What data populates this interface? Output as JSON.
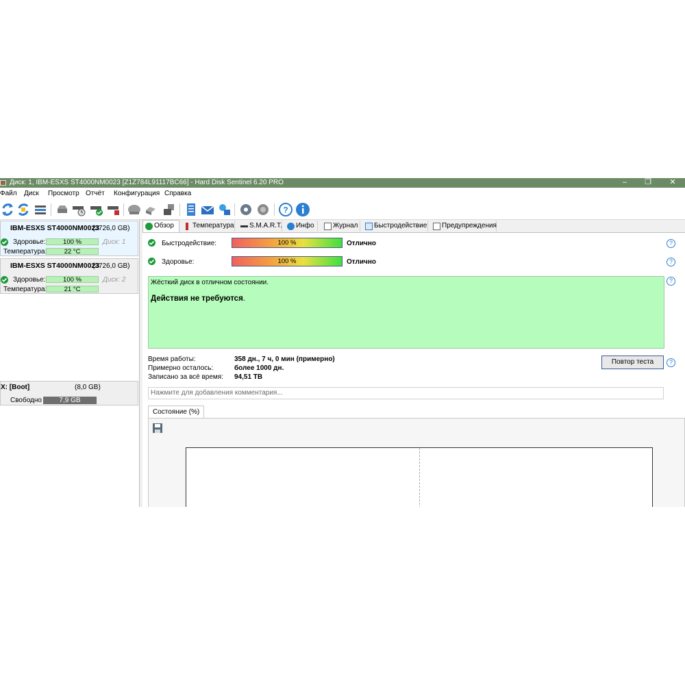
{
  "window": {
    "title": "Диск: 1, IBM-ESXS ST4000NM0023 [Z1Z784L91117BC66]  -  Hard Disk Sentinel 6.20 PRO",
    "controls": {
      "minimize": "–",
      "maximize": "❐",
      "close": "✕"
    }
  },
  "menu": [
    "Файл",
    "Диск",
    "Просмотр",
    "Отчёт",
    "Конфигурация",
    "Справка"
  ],
  "toolbar_icons": [
    "refresh-icon",
    "refresh-all-icon",
    "disk-list-icon",
    "hdd-icon",
    "disk-schedule-icon",
    "disk-ok-icon",
    "disk-stop-icon",
    "cloud-hdd-icon",
    "tools-icon",
    "surface-test-icon",
    "report-notepad-icon",
    "mail-report-icon",
    "network-icon",
    "settings-icon",
    "speaker-icon",
    "help-icon",
    "info-icon"
  ],
  "disks": [
    {
      "name": "IBM-ESXS ST4000NM0023",
      "size": "(3726,0 GB)",
      "health_label": "Здоровье:",
      "health": "100 %",
      "disk_no": "Диск: 1",
      "temp_label": "Температура:",
      "temp": "22 °C"
    },
    {
      "name": "IBM-ESXS ST4000NM0023",
      "size": "(3726,0 GB)",
      "health_label": "Здоровье:",
      "health": "100 %",
      "disk_no": "Диск: 2",
      "temp_label": "Температура:",
      "temp": "21 °C"
    }
  ],
  "volume": {
    "name": "X: [Boot]",
    "size": "(8,0 GB)",
    "free_label": "Свободно",
    "free": "7,9 GB"
  },
  "tabs": [
    "Обзор",
    "Температура",
    "S.M.A.R.T.",
    "Инфо",
    "Журнал",
    "Быстродействие",
    "Предупреждения"
  ],
  "overview": {
    "perf_label": "Быстродействие:",
    "perf_value": "100 %",
    "perf_verdict": "Отлично",
    "health_label": "Здоровье:",
    "health_value": "100 %",
    "health_verdict": "Отлично",
    "status_line1": "Жёсткий диск в отличном состоянии.",
    "status_line2_bold": "Действия не требуются",
    "status_line2_end": ".",
    "uptime_label": "Время работы:",
    "uptime_value": "358 дн., 7 ч, 0 мин (примерно)",
    "remain_label": "Примерно осталось:",
    "remain_value": "более 1000 дн.",
    "written_label": "Записано за всё время:",
    "written_value": "94,51 TB",
    "retest_button": "Повтор теста",
    "comment_placeholder": "Нажмите для добавления комментария...",
    "chart_tab": "Состояние (%)",
    "help_glyph": "?"
  },
  "colors": {
    "title_bar": "#6b8b64",
    "ok_green": "#1e9a3a",
    "status_bg": "#b6fcbc",
    "selected_disk": "#e9f5ff"
  }
}
